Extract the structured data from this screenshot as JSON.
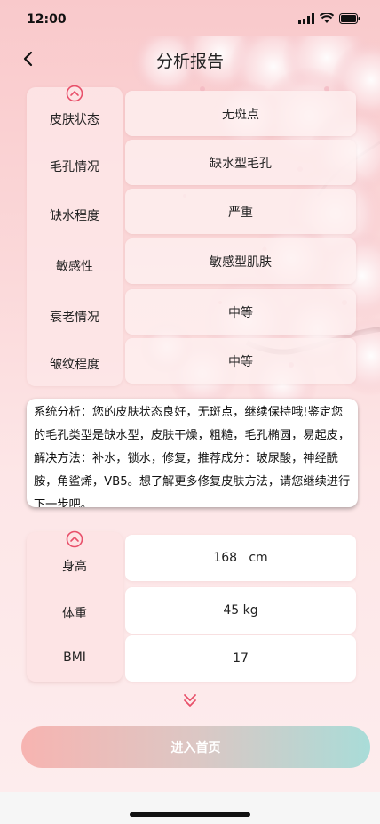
{
  "status_bar": {
    "time": "12:00"
  },
  "nav": {
    "title": "分析报告"
  },
  "skin": {
    "rows": [
      {
        "label": "皮肤状态",
        "value": "无斑点"
      },
      {
        "label": "毛孔情况",
        "value": "缺水型毛孔"
      },
      {
        "label": "缺水程度",
        "value": "严重"
      },
      {
        "label": "敏感性",
        "value": "敏感型肌肤"
      },
      {
        "label": "衰老情况",
        "value": "中等"
      },
      {
        "label": "皱纹程度",
        "value": "中等"
      }
    ]
  },
  "analysis": {
    "text": "系统分析：您的皮肤状态良好，无斑点，继续保持哦!鉴定您的毛孔类型是缺水型，皮肤干燥，粗糙，毛孔椭圆，易起皮，解决方法：补水，锁水，修复，推荐成分：玻尿酸，神经酰胺，角鲨烯，VB5。想了解更多修复皮肤方法，请您继续进行下一步吧。"
  },
  "body": {
    "rows": [
      {
        "label": "身高",
        "value": "168   cm"
      },
      {
        "label": "体重",
        "value": "45 kg"
      },
      {
        "label": "BMI",
        "value": "17"
      }
    ]
  },
  "actions": {
    "enter_label": "进入首页"
  },
  "colors": {
    "accent": "#e8506a",
    "bg": "#fbe3e4"
  },
  "icons": {
    "back": "chevron-left-icon",
    "collapse": "chevron-up-circle-icon",
    "expand": "double-chevron-down-icon"
  }
}
